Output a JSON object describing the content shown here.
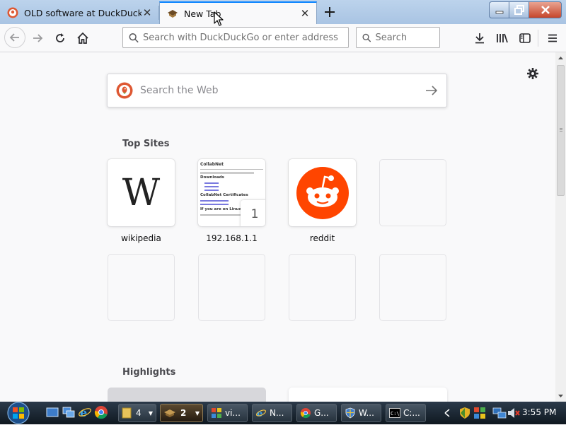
{
  "window": {
    "tabs": [
      {
        "title": "OLD software at DuckDuckGo",
        "active": false
      },
      {
        "title": "New Tab",
        "active": true
      }
    ]
  },
  "toolbar": {
    "url_placeholder": "Search with DuckDuckGo or enter address",
    "search_placeholder": "Search"
  },
  "newtab": {
    "websearch_placeholder": "Search the Web",
    "topsites_title": "Top Sites",
    "highlights_title": "Highlights",
    "topsites": [
      {
        "label": "wikipedia",
        "thumb_letter": "W"
      },
      {
        "label": "192.168.1.1",
        "badge": "1",
        "preview": {
          "heading": "CollabNet",
          "sub1": "Downloads",
          "sub2": "CollabNet Certificates",
          "sub3": "If you are on Linux, you c"
        }
      },
      {
        "label": "reddit"
      }
    ]
  },
  "taskbar": {
    "groups": [
      {
        "label": "4",
        "kind": "folder"
      },
      {
        "label": "2",
        "kind": "firefox"
      },
      {
        "label": "vi...",
        "kind": "app"
      },
      {
        "label": "N...",
        "kind": "ie"
      },
      {
        "label": "G...",
        "kind": "chrome"
      },
      {
        "label": "W...",
        "kind": "shield"
      },
      {
        "label": "C:...",
        "kind": "cmd"
      }
    ],
    "clock": "3:55 PM"
  },
  "colors": {
    "accent": "#0a84ff",
    "reddit": "#ff4500",
    "duckduckgo": "#de5833",
    "taskbar": "#1c2733"
  }
}
